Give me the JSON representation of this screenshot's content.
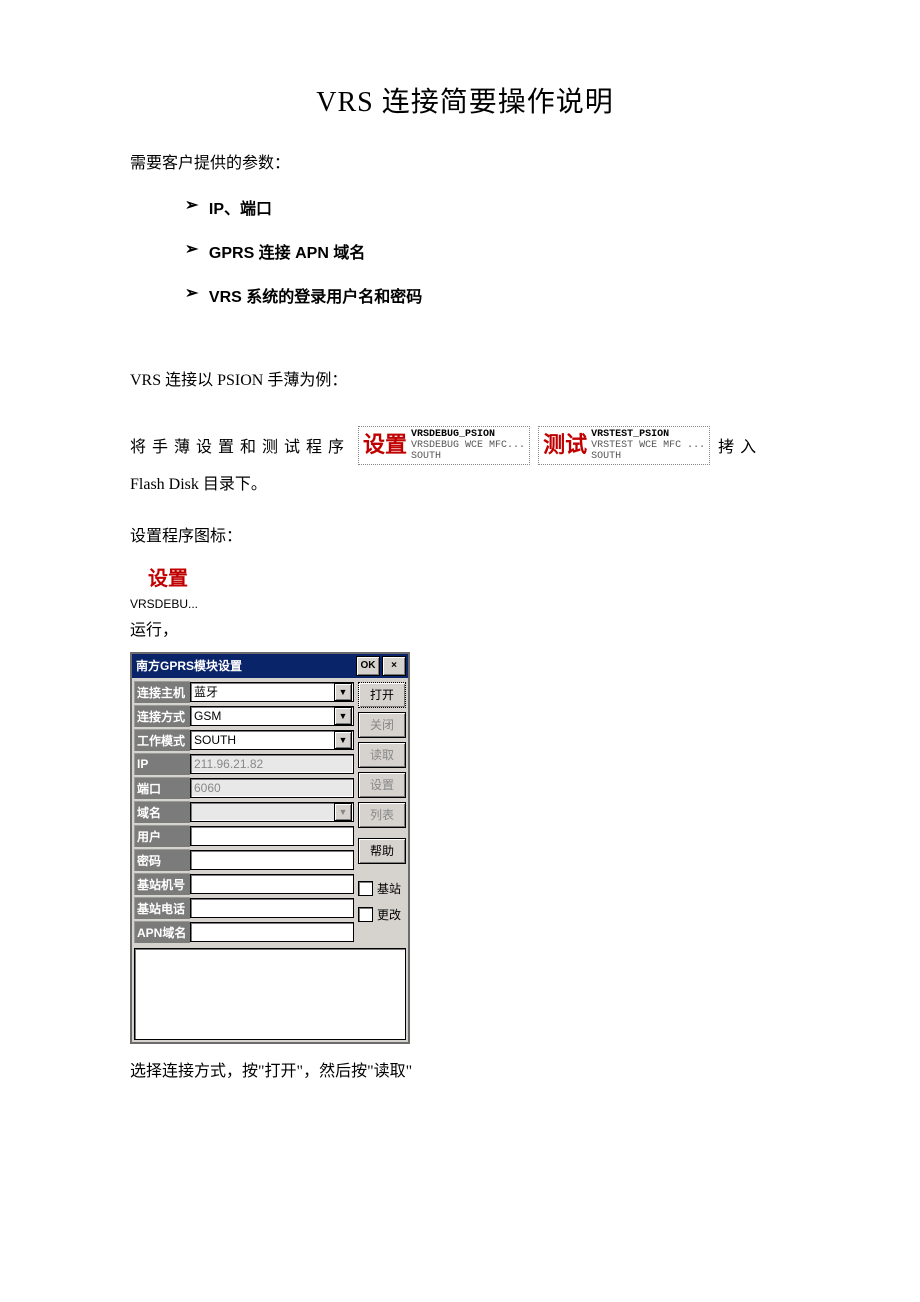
{
  "title": "VRS 连接简要操作说明",
  "intro": "需要客户提供的参数：",
  "reqs": [
    "IP、端口",
    "GPRS 连接 APN 域名",
    "VRS 系统的登录用户名和密码"
  ],
  "example_line": "VRS 连接以 PSION 手薄为例：",
  "copy_leading": "将手薄设置和测试程序",
  "copy_trailing": "拷入",
  "copy_next_line": "Flash Disk 目录下。",
  "file_cards": [
    {
      "big": "设置",
      "l1": "VRSDEBUG_PSION",
      "l2": "VRSDEBUG WCE MFC...",
      "l3": "SOUTH"
    },
    {
      "big": "测试",
      "l1": "VRSTEST_PSION",
      "l2": "VRSTEST WCE MFC ...",
      "l3": "SOUTH"
    }
  ],
  "icon_section_label": "设置程序图标：",
  "icon_big": "设置",
  "icon_caption": "VRSDEBU...",
  "run_label": "运行，",
  "dialog": {
    "title": "南方GPRS模块设置",
    "ok": "OK",
    "close": "×",
    "labels": {
      "connect_host": "连接主机",
      "connect_mode": "连接方式",
      "work_mode": "工作模式",
      "ip": "IP",
      "port": "端口",
      "domain": "域名",
      "user": "用户",
      "password": "密码",
      "base_id": "基站机号",
      "base_phone": "基站电话",
      "apn": "APN域名"
    },
    "values": {
      "connect_host": "蓝牙",
      "connect_mode": "GSM",
      "work_mode": "SOUTH",
      "ip": "211.96.21.82",
      "port": "6060",
      "domain": "",
      "user": "",
      "password": "",
      "base_id": "",
      "base_phone": "",
      "apn": ""
    },
    "buttons": {
      "open": "打开",
      "close_btn": "关闭",
      "read": "读取",
      "set": "设置",
      "list": "列表",
      "help": "帮助"
    },
    "checks": {
      "base": "基站",
      "change": "更改"
    }
  },
  "after_dialog": "选择连接方式，按\"打开\"，然后按\"读取\""
}
